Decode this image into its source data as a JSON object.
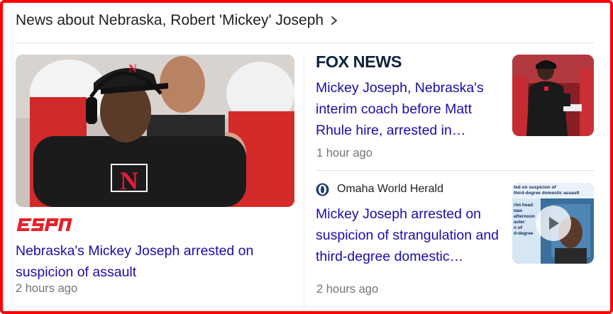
{
  "header": {
    "title": "News about Nebraska, Robert 'Mickey' Joseph"
  },
  "stories": {
    "espn": {
      "source": "ESPN",
      "headline": "Nebraska's Mickey Joseph arrested on suspicion of assault",
      "time": "2 hours ago"
    },
    "fox": {
      "source": "FOX NEWS",
      "headline": "Mickey Joseph, Nebraska's interim coach before Matt Rhule hire, arrested in…",
      "time": "1 hour ago"
    },
    "owh": {
      "source": "Omaha World Herald",
      "headline": "Mickey Joseph arrested on suspicion of strangulation and third-degree domestic…",
      "time": "2 hours ago",
      "thumb_caption_lines": [
        "ted on suspicion of",
        "third-degree domestic assault"
      ],
      "thumb_side_lines": [
        "rim head",
        "was",
        "afternoon",
        "aster",
        "n of",
        "d-degree"
      ]
    }
  },
  "colors": {
    "link": "#1a0dab",
    "meta": "#70757a",
    "frame": "#ff0000",
    "espn_red": "#e8202a",
    "fox_navy": "#0c2340",
    "huskers_red": "#e41c38"
  },
  "icons": {
    "heading_chevron": "chevron-right-icon",
    "video_play": "play-icon"
  }
}
